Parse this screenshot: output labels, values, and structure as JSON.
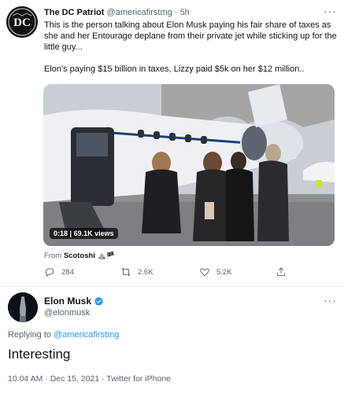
{
  "quoted_tweet": {
    "author_name": "The DC Patriot",
    "author_handle": "@americafirstmg",
    "separator": "·",
    "time": "5h",
    "more_label": "···",
    "text_paragraphs": [
      "This is the person talking about Elon Musk paying his fair share of taxes as she and her Entourage deplane from their private jet while sticking up for the little guy...",
      "Elon's paying $15 billion in taxes, Lizzy paid $5k on her $12 million.."
    ],
    "video": {
      "duration": "0:18",
      "views": "69.1K views"
    },
    "from_prefix": "From",
    "from_name": "Scotoshi",
    "from_emoji": "⛰️🏴",
    "actions": {
      "replies": "284",
      "retweets": "2.6K",
      "likes": "5.2K"
    }
  },
  "main_tweet": {
    "author_name": "Elon Musk",
    "author_handle": "@elonmusk",
    "more_label": "···",
    "replying_prefix": "Replying to",
    "replying_to": "@americafirstmg",
    "text": "Interesting",
    "timestamp": "10:04 AM · Dec 15, 2021 · Twitter for iPhone"
  },
  "colors": {
    "accent": "#1d9bf0",
    "text_primary": "#0f1419",
    "text_secondary": "#536471",
    "verified": "#1d9bf0"
  },
  "icons": [
    "dc-patriot-logo",
    "reply-icon",
    "retweet-icon",
    "like-icon",
    "share-icon",
    "verified-icon",
    "more-icon"
  ]
}
